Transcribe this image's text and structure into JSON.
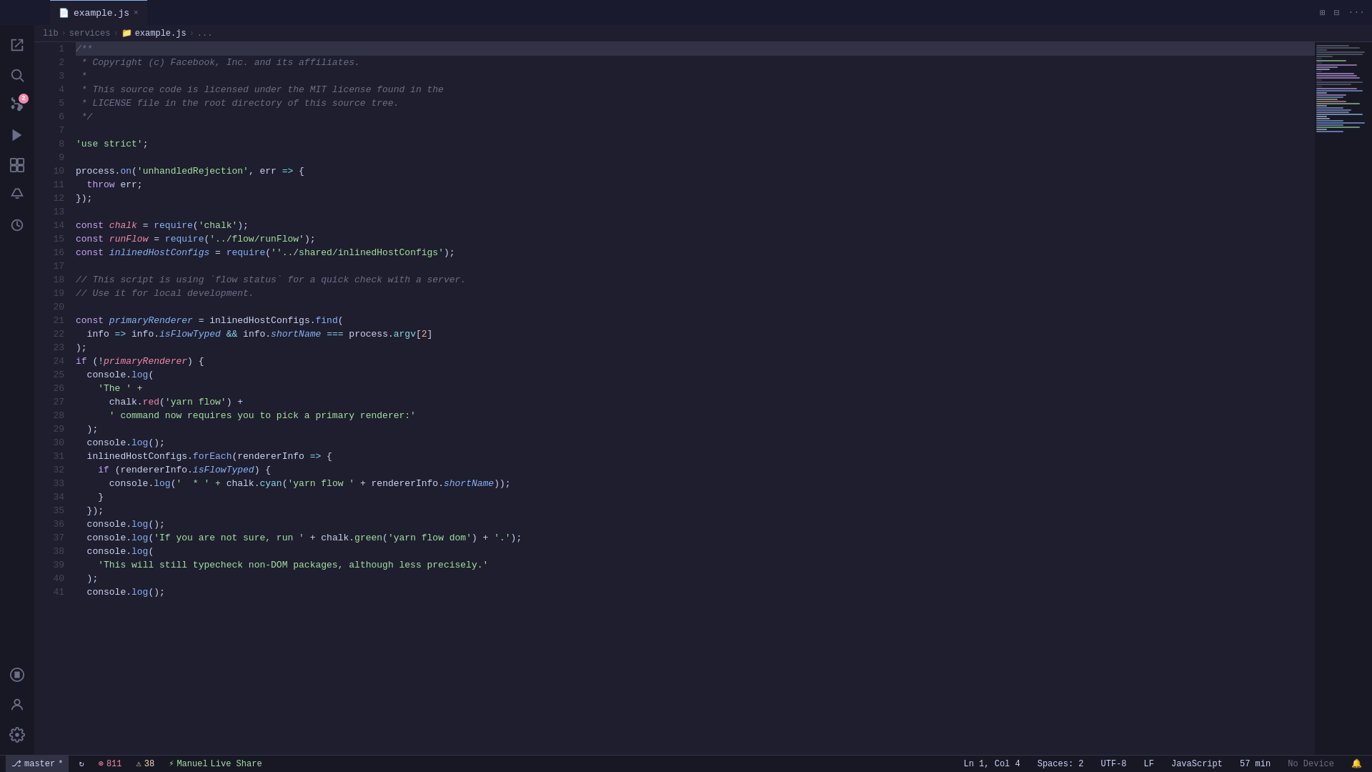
{
  "titlebar": {
    "tab_icon": "JS",
    "tab_name": "example.js",
    "close_label": "×"
  },
  "breadcrumb": {
    "parts": [
      "lib",
      ">",
      "services",
      ">",
      "example.js",
      ">",
      "..."
    ]
  },
  "code": {
    "lines": [
      {
        "n": 1,
        "tokens": [
          {
            "t": "comment",
            "v": "/**"
          }
        ]
      },
      {
        "n": 2,
        "tokens": [
          {
            "t": "comment",
            "v": " * Copyright (c) Facebook, Inc. and its affiliates."
          }
        ]
      },
      {
        "n": 3,
        "tokens": [
          {
            "t": "comment",
            "v": " *"
          }
        ]
      },
      {
        "n": 4,
        "tokens": [
          {
            "t": "comment",
            "v": " * This source code is licensed under the MIT license found in the"
          }
        ]
      },
      {
        "n": 5,
        "tokens": [
          {
            "t": "comment",
            "v": " * LICENSE file in the root directory of this source tree."
          }
        ]
      },
      {
        "n": 6,
        "tokens": [
          {
            "t": "comment",
            "v": " */"
          }
        ]
      },
      {
        "n": 7,
        "tokens": []
      },
      {
        "n": 8,
        "tokens": [
          {
            "t": "string",
            "v": "'use strict'"
          },
          {
            "t": "plain",
            "v": ";"
          }
        ]
      },
      {
        "n": 9,
        "tokens": []
      },
      {
        "n": 10,
        "tokens": [
          {
            "t": "plain",
            "v": "process."
          },
          {
            "t": "func",
            "v": "on"
          },
          {
            "t": "plain",
            "v": "("
          },
          {
            "t": "string",
            "v": "'unhandledRejection'"
          },
          {
            "t": "plain",
            "v": ", err "
          },
          {
            "t": "op",
            "v": "=>"
          },
          {
            "t": "plain",
            "v": " {"
          }
        ]
      },
      {
        "n": 11,
        "tokens": [
          {
            "t": "plain",
            "v": "  "
          },
          {
            "t": "kw",
            "v": "throw"
          },
          {
            "t": "plain",
            "v": " err;"
          }
        ]
      },
      {
        "n": 12,
        "tokens": [
          {
            "t": "plain",
            "v": "});"
          }
        ]
      },
      {
        "n": 13,
        "tokens": []
      },
      {
        "n": 14,
        "tokens": [
          {
            "t": "kw",
            "v": "const"
          },
          {
            "t": "plain",
            "v": " "
          },
          {
            "t": "italic",
            "v": "chalk"
          },
          {
            "t": "plain",
            "v": " = "
          },
          {
            "t": "func",
            "v": "require"
          },
          {
            "t": "plain",
            "v": "("
          },
          {
            "t": "string",
            "v": "'chalk'"
          },
          {
            "t": "plain",
            "v": ");"
          }
        ]
      },
      {
        "n": 15,
        "tokens": [
          {
            "t": "kw",
            "v": "const"
          },
          {
            "t": "plain",
            "v": " "
          },
          {
            "t": "italic",
            "v": "runFlow"
          },
          {
            "t": "plain",
            "v": " = "
          },
          {
            "t": "func",
            "v": "require"
          },
          {
            "t": "plain",
            "v": "("
          },
          {
            "t": "string",
            "v": "'../flow/runFlow'"
          },
          {
            "t": "plain",
            "v": ");"
          }
        ]
      },
      {
        "n": 16,
        "tokens": [
          {
            "t": "kw",
            "v": "const"
          },
          {
            "t": "plain",
            "v": " "
          },
          {
            "t": "italic_prop",
            "v": "inlinedHostConfigs"
          },
          {
            "t": "plain",
            "v": " = "
          },
          {
            "t": "func",
            "v": "require"
          },
          {
            "t": "plain",
            "v": "("
          },
          {
            "t": "string",
            "v": "'../shared/inlinedHostConfigs'"
          },
          {
            "t": "plain",
            "v": ");"
          }
        ]
      },
      {
        "n": 17,
        "tokens": []
      },
      {
        "n": 18,
        "tokens": [
          {
            "t": "comment",
            "v": "// This script is using `flow status` for a quick check with a server."
          }
        ]
      },
      {
        "n": 19,
        "tokens": [
          {
            "t": "comment",
            "v": "// Use it for local development."
          }
        ]
      },
      {
        "n": 20,
        "tokens": []
      },
      {
        "n": 21,
        "tokens": [
          {
            "t": "kw",
            "v": "const"
          },
          {
            "t": "plain",
            "v": " "
          },
          {
            "t": "italic_prop",
            "v": "primaryRenderer"
          },
          {
            "t": "plain",
            "v": " = inlinedHostConfigs."
          },
          {
            "t": "func",
            "v": "find"
          },
          {
            "t": "plain",
            "v": "("
          }
        ]
      },
      {
        "n": 22,
        "tokens": [
          {
            "t": "plain",
            "v": "  info "
          },
          {
            "t": "op",
            "v": "=>"
          },
          {
            "t": "plain",
            "v": " info."
          },
          {
            "t": "prop",
            "v": "isFlowTyped"
          },
          {
            "t": "plain",
            "v": " "
          },
          {
            "t": "op2",
            "v": "&&"
          },
          {
            "t": "plain",
            "v": " info."
          },
          {
            "t": "prop",
            "v": "shortName"
          },
          {
            "t": "plain",
            "v": " "
          },
          {
            "t": "op3",
            "v": "==="
          },
          {
            "t": "plain",
            "v": " process."
          },
          {
            "t": "prop2",
            "v": "argv"
          },
          {
            "t": "plain",
            "v": "["
          },
          {
            "t": "num",
            "v": "2"
          },
          {
            "t": "plain",
            "v": "]"
          }
        ]
      },
      {
        "n": 23,
        "tokens": [
          {
            "t": "plain",
            "v": ");"
          }
        ]
      },
      {
        "n": 24,
        "tokens": [
          {
            "t": "kw",
            "v": "if"
          },
          {
            "t": "plain",
            "v": " (!"
          },
          {
            "t": "italic",
            "v": "primaryRenderer"
          },
          {
            "t": "plain",
            "v": ") {"
          }
        ]
      },
      {
        "n": 25,
        "tokens": [
          {
            "t": "plain",
            "v": "  console."
          },
          {
            "t": "func",
            "v": "log"
          },
          {
            "t": "plain",
            "v": "("
          }
        ]
      },
      {
        "n": 26,
        "tokens": [
          {
            "t": "plain",
            "v": "    "
          },
          {
            "t": "string",
            "v": "'The ' +"
          }
        ]
      },
      {
        "n": 27,
        "tokens": [
          {
            "t": "plain",
            "v": "      chalk."
          },
          {
            "t": "red",
            "v": "red"
          },
          {
            "t": "plain",
            "v": "("
          },
          {
            "t": "string",
            "v": "'yarn flow'"
          },
          {
            "t": "plain",
            "v": ") +"
          }
        ]
      },
      {
        "n": 28,
        "tokens": [
          {
            "t": "plain",
            "v": "      "
          },
          {
            "t": "string",
            "v": "' command now requires you to pick a primary renderer:'"
          }
        ]
      },
      {
        "n": 29,
        "tokens": [
          {
            "t": "plain",
            "v": "  );"
          }
        ]
      },
      {
        "n": 30,
        "tokens": [
          {
            "t": "plain",
            "v": "  console."
          },
          {
            "t": "func",
            "v": "log"
          },
          {
            "t": "plain",
            "v": "();"
          }
        ]
      },
      {
        "n": 31,
        "tokens": [
          {
            "t": "plain",
            "v": "  inlinedHostConfigs."
          },
          {
            "t": "func",
            "v": "forEach"
          },
          {
            "t": "plain",
            "v": "(rendererInfo "
          },
          {
            "t": "op",
            "v": "=>"
          },
          {
            "t": "plain",
            "v": " {"
          }
        ]
      },
      {
        "n": 32,
        "tokens": [
          {
            "t": "plain",
            "v": "    "
          },
          {
            "t": "kw",
            "v": "if"
          },
          {
            "t": "plain",
            "v": " (rendererInfo."
          },
          {
            "t": "italic_prop2",
            "v": "isFlowTyped"
          },
          {
            "t": "plain",
            "v": ") {"
          }
        ]
      },
      {
        "n": 33,
        "tokens": [
          {
            "t": "plain",
            "v": "      console."
          },
          {
            "t": "func",
            "v": "log"
          },
          {
            "t": "plain",
            "v": "("
          },
          {
            "t": "string",
            "v": "'  * ' +"
          },
          {
            "t": "plain",
            "v": " chalk."
          },
          {
            "t": "cyan",
            "v": "cyan"
          },
          {
            "t": "plain",
            "v": "("
          },
          {
            "t": "string",
            "v": "'yarn flow '"
          },
          {
            "t": "plain",
            "v": " + rendererInfo."
          },
          {
            "t": "prop",
            "v": "shortName"
          },
          {
            "t": "plain",
            "v": "));"
          }
        ]
      },
      {
        "n": 34,
        "tokens": [
          {
            "t": "plain",
            "v": "    }"
          }
        ]
      },
      {
        "n": 35,
        "tokens": [
          {
            "t": "plain",
            "v": "  });"
          }
        ]
      },
      {
        "n": 36,
        "tokens": [
          {
            "t": "plain",
            "v": "  console."
          },
          {
            "t": "func",
            "v": "log"
          },
          {
            "t": "plain",
            "v": "();"
          }
        ]
      },
      {
        "n": 37,
        "tokens": [
          {
            "t": "plain",
            "v": "  console."
          },
          {
            "t": "func",
            "v": "log"
          },
          {
            "t": "plain",
            "v": "("
          },
          {
            "t": "string",
            "v": "'If you are not sure, run '"
          },
          {
            "t": "plain",
            "v": " + chalk."
          },
          {
            "t": "green",
            "v": "green"
          },
          {
            "t": "plain",
            "v": "("
          },
          {
            "t": "string",
            "v": "'yarn flow dom'"
          },
          {
            "t": "plain",
            "v": ") + "
          },
          {
            "t": "string",
            "v": "'.'"
          },
          {
            "t": "plain",
            "v": ");"
          }
        ]
      },
      {
        "n": 38,
        "tokens": [
          {
            "t": "plain",
            "v": "  console."
          },
          {
            "t": "func",
            "v": "log"
          },
          {
            "t": "plain",
            "v": "("
          }
        ]
      },
      {
        "n": 39,
        "tokens": [
          {
            "t": "plain",
            "v": "    "
          },
          {
            "t": "string",
            "v": "'This will still typecheck non-DOM packages, although less precisely.'"
          }
        ]
      },
      {
        "n": 40,
        "tokens": [
          {
            "t": "plain",
            "v": "  );"
          }
        ]
      },
      {
        "n": 41,
        "tokens": [
          {
            "t": "plain",
            "v": "  console."
          },
          {
            "t": "func",
            "v": "log"
          },
          {
            "t": "plain",
            "v": "();"
          }
        ]
      }
    ]
  },
  "status": {
    "branch": "master",
    "sync_icon": "↻",
    "errors": "811",
    "error_icon": "⊗",
    "warnings": "38",
    "warning_icon": "⚠",
    "live_share_icon": "⚡",
    "live_share_user": "Manuel",
    "live_share_label": "Live Share",
    "position": "Ln 1, Col 4",
    "spaces": "Spaces: 2",
    "encoding": "UTF-8",
    "line_ending": "LF",
    "language": "JavaScript",
    "time": "57 min",
    "no_device": "No Device",
    "bell_icon": "🔔",
    "person_icon": "👤"
  }
}
